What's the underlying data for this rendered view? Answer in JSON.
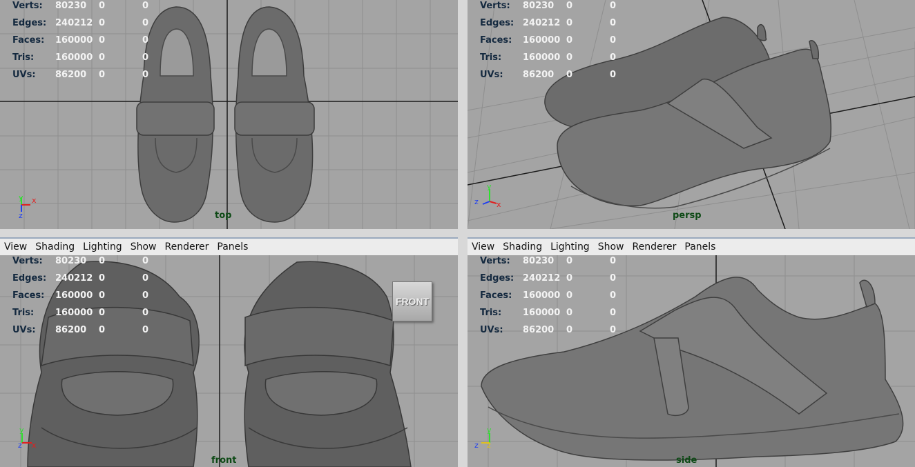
{
  "menu": [
    "View",
    "Shading",
    "Lighting",
    "Show",
    "Renderer",
    "Panels"
  ],
  "stats": [
    {
      "label": "Verts:",
      "a": "80230",
      "b": "0",
      "c": "0"
    },
    {
      "label": "Edges:",
      "a": "240212",
      "b": "0",
      "c": "0"
    },
    {
      "label": "Faces:",
      "a": "160000",
      "b": "0",
      "c": "0"
    },
    {
      "label": "Tris:",
      "a": "160000",
      "b": "0",
      "c": "0"
    },
    {
      "label": "UVs:",
      "a": "86200",
      "b": "0",
      "c": "0"
    }
  ],
  "viewports": {
    "top": {
      "camera": "top",
      "axis_h": "x",
      "axis_v": "z",
      "axis_up": "y"
    },
    "persp": {
      "camera": "persp",
      "axis_h": "x",
      "axis_v": "y",
      "axis_z": "z"
    },
    "front": {
      "camera": "front",
      "axis_h": "x",
      "axis_v": "y",
      "axis_z": "z",
      "cube": "FRONT"
    },
    "side": {
      "camera": "side",
      "axis_h": "z",
      "axis_v": "y",
      "axis_z": "z"
    }
  },
  "colors": {
    "viewport_bg": "#a4a4a4",
    "grid": "#8e8e8e",
    "axis_line": "#1a1a1a",
    "hud_value": "#f3f3f3",
    "hud_label": "#14293f",
    "camera_label": "#0e4a16",
    "model": "#6b6b6b"
  }
}
